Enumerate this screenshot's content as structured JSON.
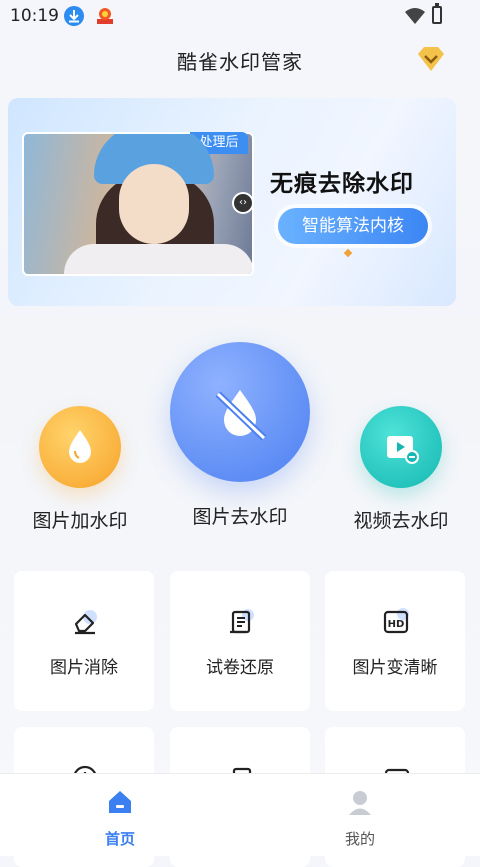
{
  "status_bar": {
    "time": "10:19"
  },
  "header": {
    "title": "酷雀水印管家"
  },
  "banner": {
    "tag": "处理后",
    "headline": "无痕去除水印",
    "pill": "智能算法内核"
  },
  "features": [
    {
      "label": "图片加水印",
      "icon": "water-drop-icon",
      "color": "#fbb33a"
    },
    {
      "label": "图片去水印",
      "icon": "no-water-drop-icon",
      "color": "#4f86f7"
    },
    {
      "label": "视频去水印",
      "icon": "video-icon",
      "color": "#1fc7c0"
    }
  ],
  "tools": [
    {
      "label": "图片消除",
      "icon": "eraser-icon"
    },
    {
      "label": "试卷还原",
      "icon": "scroll-icon"
    },
    {
      "label": "图片变清晰",
      "icon": "hd-icon"
    }
  ],
  "nav": [
    {
      "label": "首页",
      "icon": "home-icon",
      "active": true
    },
    {
      "label": "我的",
      "icon": "user-icon",
      "active": false
    }
  ],
  "colors": {
    "accent": "#3c7ff0",
    "nav_inactive": "#555555"
  }
}
